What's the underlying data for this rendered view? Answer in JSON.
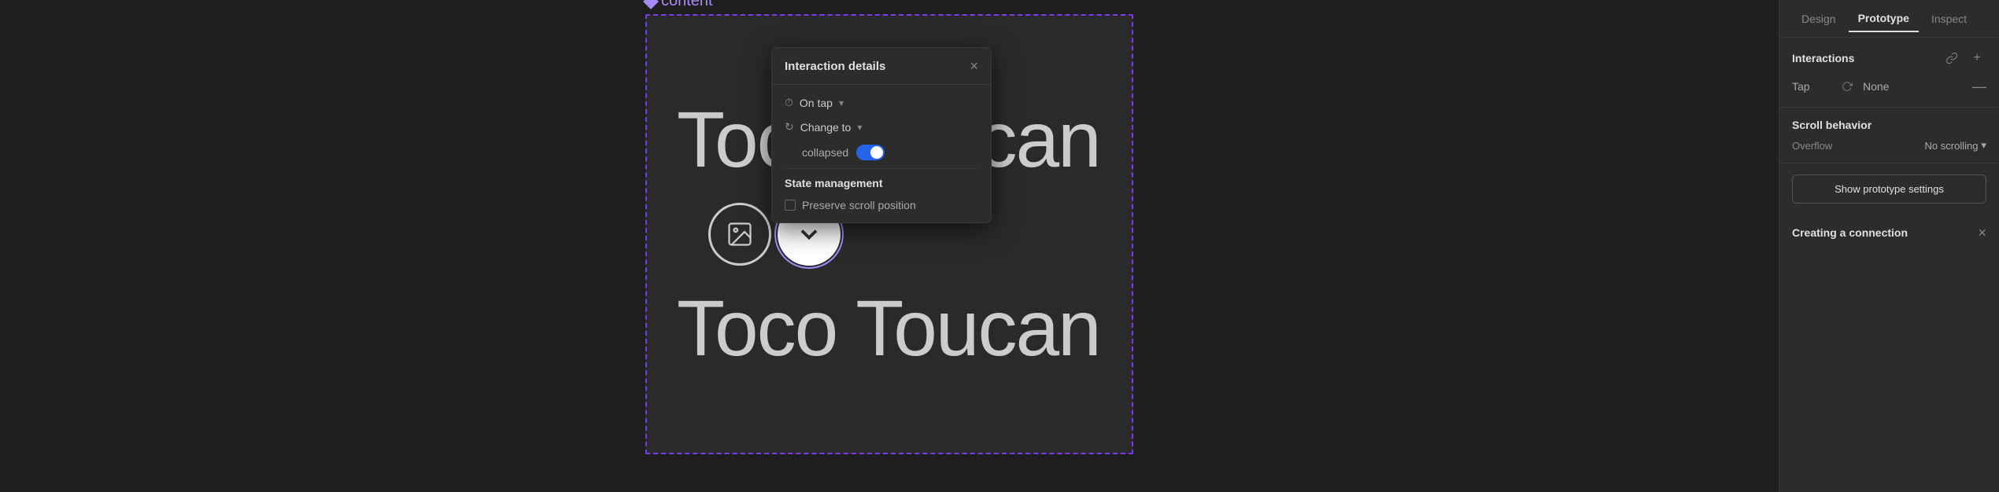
{
  "canvas": {
    "frame_label": "content",
    "text_top": "Toco Toucan",
    "text_bottom": "Toco Toucan"
  },
  "interaction_panel": {
    "title": "Interaction details",
    "close_label": "×",
    "on_tap_label": "On tap",
    "change_to_label": "Change to",
    "collapsed_label": "collapsed",
    "state_management_title": "State management",
    "preserve_scroll_label": "Preserve scroll position"
  },
  "sidebar": {
    "tabs": [
      {
        "label": "Design",
        "active": false
      },
      {
        "label": "Prototype",
        "active": true
      },
      {
        "label": "Inspect",
        "active": false
      }
    ],
    "interactions_title": "Interactions",
    "tap_label": "Tap",
    "none_label": "None",
    "refresh_icon": "↻",
    "plus_icon": "+",
    "minus_icon": "—",
    "scroll_behavior_title": "Scroll behavior",
    "overflow_label": "Overflow",
    "no_scrolling_label": "No scrolling",
    "show_prototype_settings_label": "Show prototype settings",
    "creating_connection_title": "Creating a connection",
    "close_creating_label": "×"
  }
}
